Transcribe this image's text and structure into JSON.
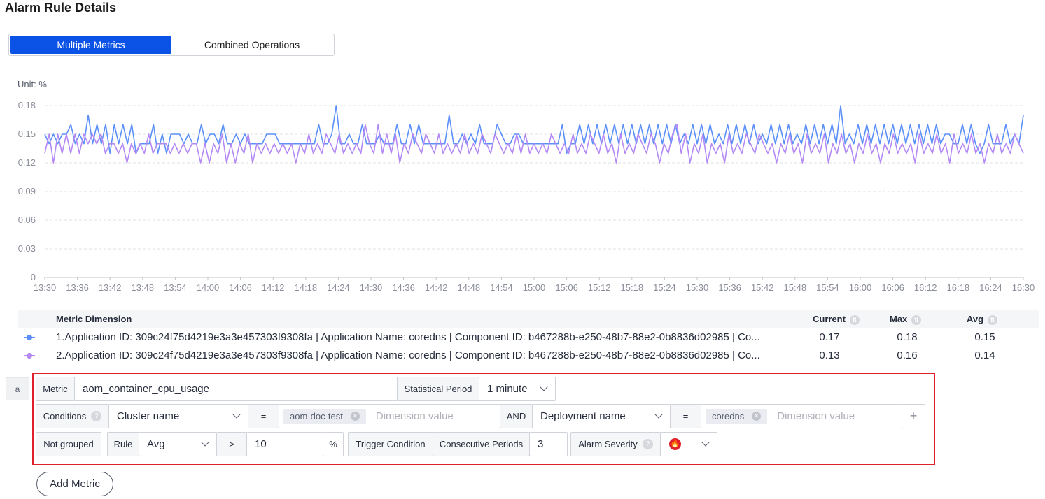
{
  "page": {
    "title": "Alarm Rule Details"
  },
  "tabs": {
    "multiple": "Multiple Metrics",
    "combined": "Combined Operations",
    "active": "multiple"
  },
  "chart_data": {
    "type": "line",
    "unit_label": "Unit: %",
    "ylim": [
      0,
      0.18
    ],
    "yticks": [
      "0",
      "0.03",
      "0.06",
      "0.09",
      "0.12",
      "0.15",
      "0.18"
    ],
    "xticks": [
      "13:30",
      "13:36",
      "13:42",
      "13:48",
      "13:54",
      "14:00",
      "14:06",
      "14:12",
      "14:18",
      "14:24",
      "14:30",
      "14:36",
      "14:42",
      "14:48",
      "14:54",
      "15:00",
      "15:06",
      "15:12",
      "15:18",
      "15:24",
      "15:30",
      "15:36",
      "15:42",
      "15:48",
      "15:54",
      "16:00",
      "16:06",
      "16:12",
      "16:18",
      "16:24",
      "16:30"
    ],
    "grid": true,
    "series": [
      {
        "color": "#5b8ff9",
        "values": [
          0.15,
          0.14,
          0.15,
          0.14,
          0.15,
          0.15,
          0.16,
          0.14,
          0.15,
          0.14,
          0.17,
          0.14,
          0.16,
          0.14,
          0.16,
          0.13,
          0.16,
          0.14,
          0.16,
          0.14,
          0.16,
          0.13,
          0.14,
          0.14,
          0.14,
          0.16,
          0.13,
          0.15,
          0.13,
          0.15,
          0.15,
          0.15,
          0.14,
          0.15,
          0.14,
          0.14,
          0.16,
          0.14,
          0.15,
          0.15,
          0.14,
          0.16,
          0.14,
          0.14,
          0.15,
          0.14,
          0.15,
          0.14,
          0.14,
          0.14,
          0.14,
          0.15,
          0.15,
          0.15,
          0.14,
          0.14,
          0.14,
          0.14,
          0.14,
          0.14,
          0.14,
          0.14,
          0.14,
          0.16,
          0.14,
          0.14,
          0.15,
          0.18,
          0.14,
          0.14,
          0.15,
          0.14,
          0.14,
          0.16,
          0.14,
          0.14,
          0.14,
          0.15,
          0.14,
          0.14,
          0.14,
          0.16,
          0.14,
          0.14,
          0.16,
          0.14,
          0.16,
          0.14,
          0.14,
          0.14,
          0.14,
          0.14,
          0.14,
          0.17,
          0.14,
          0.14,
          0.15,
          0.14,
          0.15,
          0.14,
          0.16,
          0.14,
          0.14,
          0.14,
          0.16,
          0.15,
          0.14,
          0.14,
          0.15,
          0.15,
          0.14,
          0.14,
          0.14,
          0.14,
          0.14,
          0.14,
          0.14,
          0.14,
          0.14,
          0.16,
          0.13,
          0.14,
          0.14,
          0.16,
          0.14,
          0.16,
          0.14,
          0.16,
          0.14,
          0.16,
          0.14,
          0.16,
          0.14,
          0.16,
          0.14,
          0.16,
          0.14,
          0.16,
          0.14,
          0.16,
          0.14,
          0.16,
          0.14,
          0.16,
          0.14,
          0.16,
          0.14,
          0.15,
          0.14,
          0.16,
          0.14,
          0.16,
          0.14,
          0.16,
          0.14,
          0.15,
          0.14,
          0.16,
          0.14,
          0.16,
          0.14,
          0.16,
          0.14,
          0.16,
          0.14,
          0.15,
          0.14,
          0.16,
          0.14,
          0.16,
          0.14,
          0.16,
          0.14,
          0.15,
          0.14,
          0.16,
          0.14,
          0.16,
          0.14,
          0.16,
          0.14,
          0.16,
          0.14,
          0.18,
          0.14,
          0.15,
          0.14,
          0.16,
          0.14,
          0.16,
          0.14,
          0.16,
          0.14,
          0.16,
          0.14,
          0.16,
          0.14,
          0.16,
          0.14,
          0.16,
          0.14,
          0.16,
          0.14,
          0.16,
          0.14,
          0.16,
          0.14,
          0.15,
          0.15,
          0.14,
          0.14,
          0.16,
          0.14,
          0.16,
          0.14,
          0.13,
          0.14,
          0.16,
          0.14,
          0.14,
          0.14,
          0.16,
          0.14,
          0.15,
          0.14,
          0.17
        ]
      },
      {
        "color": "#b388f5",
        "values": [
          0.13,
          0.15,
          0.12,
          0.15,
          0.13,
          0.15,
          0.13,
          0.15,
          0.13,
          0.15,
          0.14,
          0.15,
          0.14,
          0.15,
          0.13,
          0.14,
          0.14,
          0.13,
          0.14,
          0.12,
          0.14,
          0.13,
          0.14,
          0.13,
          0.15,
          0.13,
          0.14,
          0.14,
          0.14,
          0.13,
          0.14,
          0.13,
          0.14,
          0.13,
          0.14,
          0.14,
          0.12,
          0.14,
          0.12,
          0.14,
          0.13,
          0.15,
          0.12,
          0.14,
          0.12,
          0.14,
          0.13,
          0.15,
          0.12,
          0.14,
          0.13,
          0.14,
          0.13,
          0.14,
          0.13,
          0.14,
          0.13,
          0.14,
          0.12,
          0.14,
          0.13,
          0.15,
          0.13,
          0.14,
          0.13,
          0.15,
          0.14,
          0.13,
          0.15,
          0.13,
          0.14,
          0.13,
          0.14,
          0.13,
          0.16,
          0.14,
          0.13,
          0.16,
          0.13,
          0.15,
          0.13,
          0.15,
          0.12,
          0.14,
          0.13,
          0.15,
          0.14,
          0.13,
          0.15,
          0.14,
          0.13,
          0.15,
          0.13,
          0.14,
          0.13,
          0.14,
          0.13,
          0.15,
          0.13,
          0.14,
          0.13,
          0.15,
          0.14,
          0.13,
          0.15,
          0.14,
          0.13,
          0.14,
          0.13,
          0.15,
          0.13,
          0.15,
          0.13,
          0.14,
          0.13,
          0.14,
          0.13,
          0.15,
          0.14,
          0.13,
          0.14,
          0.13,
          0.15,
          0.13,
          0.14,
          0.13,
          0.15,
          0.14,
          0.13,
          0.15,
          0.13,
          0.14,
          0.12,
          0.15,
          0.13,
          0.14,
          0.13,
          0.15,
          0.14,
          0.13,
          0.15,
          0.14,
          0.12,
          0.14,
          0.13,
          0.15,
          0.16,
          0.13,
          0.15,
          0.12,
          0.14,
          0.13,
          0.15,
          0.12,
          0.14,
          0.13,
          0.14,
          0.12,
          0.15,
          0.13,
          0.14,
          0.13,
          0.15,
          0.14,
          0.13,
          0.15,
          0.14,
          0.13,
          0.14,
          0.12,
          0.14,
          0.13,
          0.15,
          0.13,
          0.14,
          0.12,
          0.15,
          0.13,
          0.14,
          0.13,
          0.15,
          0.12,
          0.14,
          0.13,
          0.15,
          0.13,
          0.14,
          0.12,
          0.14,
          0.13,
          0.15,
          0.13,
          0.14,
          0.12,
          0.14,
          0.13,
          0.15,
          0.13,
          0.14,
          0.13,
          0.14,
          0.12,
          0.15,
          0.13,
          0.14,
          0.13,
          0.15,
          0.13,
          0.14,
          0.12,
          0.15,
          0.13,
          0.14,
          0.13,
          0.15,
          0.13,
          0.14,
          0.12,
          0.14,
          0.13,
          0.15,
          0.13,
          0.14,
          0.13,
          0.15,
          0.14,
          0.13
        ]
      }
    ]
  },
  "table": {
    "headers": {
      "dimension": "Metric Dimension",
      "current": "Current",
      "max": "Max",
      "avg": "Avg"
    },
    "rows": [
      {
        "dimension": "1.Application ID: 309c24f75d4219e3a3e457303f9308fa | Application Name: coredns | Component ID: b467288b-e250-48b7-88e2-0b8836d02985 | Co...",
        "current": "0.17",
        "max": "0.18",
        "avg": "0.15",
        "color": "#5b8ff9"
      },
      {
        "dimension": "2.Application ID: 309c24f75d4219e3a3e457303f9308fa | Application Name: coredns | Component ID: b467288b-e250-48b7-88e2-0b8836d02985 | Co...",
        "current": "0.13",
        "max": "0.16",
        "avg": "0.14",
        "color": "#b388f5"
      }
    ]
  },
  "rule": {
    "tag": "a",
    "metric_label": "Metric",
    "metric_value": "aom_container_cpu_usage",
    "period_label": "Statistical Period",
    "period_value": "1 minute",
    "conditions_label": "Conditions",
    "cond1_dimension": "Cluster name",
    "eq": "=",
    "cond1_chip": "aom-doc-test",
    "dim_placeholder": "Dimension value",
    "and": "AND",
    "cond2_dimension": "Deployment name",
    "cond2_chip": "coredns",
    "plus": "+",
    "grouping": "Not grouped",
    "rule_label": "Rule",
    "rule_stat": "Avg",
    "operator": ">",
    "threshold": "10",
    "percent": "%",
    "trigger_label": "Trigger Condition",
    "consec_label": "Consecutive Periods",
    "consec_value": "3",
    "severity_label": "Alarm Severity",
    "severity_color": "#e0212b"
  },
  "add_metric": "Add Metric"
}
